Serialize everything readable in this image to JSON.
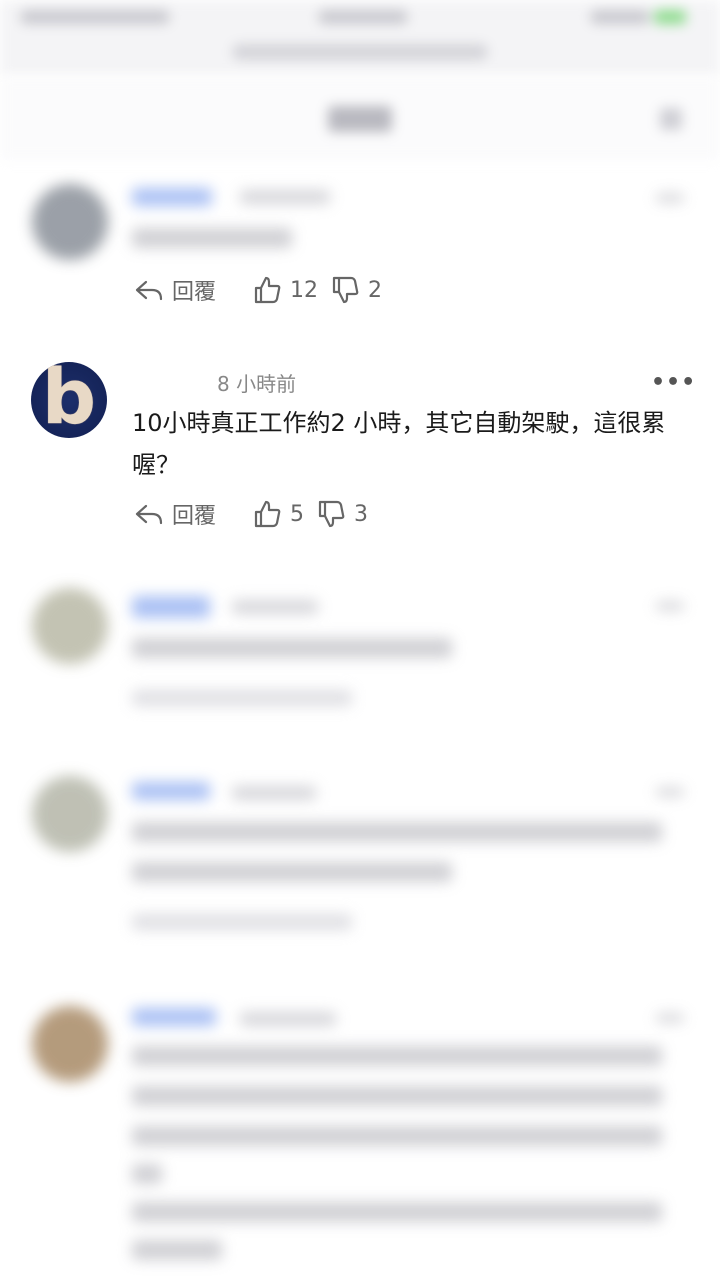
{
  "comments": [
    {
      "id": "c1",
      "blurred": true,
      "reply_label": "回覆",
      "likes": "12",
      "dislikes": "2"
    },
    {
      "id": "c2",
      "blurred": false,
      "avatar_letter": "b",
      "author": "",
      "time": "8 小時前",
      "more": "•••",
      "text": "10小時真正工作約2 小時，其它自動架駛，這很累喔？",
      "reply_label": "回覆",
      "likes": "5",
      "dislikes": "3"
    }
  ],
  "icons": {
    "reply": "reply-arrow-icon",
    "like": "thumbs-up-icon",
    "dislike": "thumbs-down-icon",
    "more": "more-dots-icon"
  },
  "colors": {
    "avatar_bg": "#152459",
    "avatar_letter": "#e8d9c6",
    "author_link": "#3d6fe8"
  }
}
